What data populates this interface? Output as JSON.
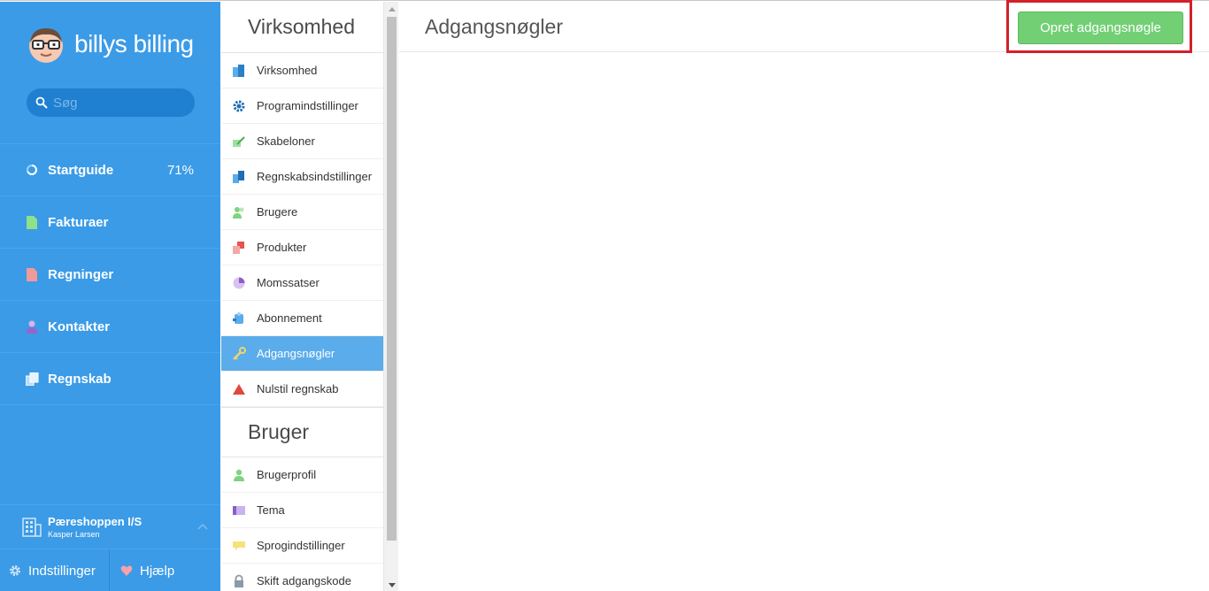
{
  "brand": {
    "name": "billys billing"
  },
  "search": {
    "placeholder": "Søg"
  },
  "sidebar": {
    "items": [
      {
        "label": "Startguide",
        "percent": "71%"
      },
      {
        "label": "Fakturaer"
      },
      {
        "label": "Regninger"
      },
      {
        "label": "Kontakter"
      },
      {
        "label": "Regnskab"
      }
    ],
    "org_name": "Pæreshoppen I/S",
    "org_user": "Kasper Larsen",
    "settings_label": "Indstillinger",
    "help_label": "Hjælp"
  },
  "settings": {
    "company_title": "Virksomhed",
    "company_items": [
      "Virksomhed",
      "Programindstillinger",
      "Skabeloner",
      "Regnskabsindstillinger",
      "Brugere",
      "Produkter",
      "Momssatser",
      "Abonnement",
      "Adgangsnøgler",
      "Nulstil regnskab"
    ],
    "user_title": "Bruger",
    "user_items": [
      "Brugerprofil",
      "Tema",
      "Sprogindstillinger",
      "Skift adgangskode"
    ],
    "active": "Adgangsnøgler"
  },
  "main": {
    "title": "Adgangsnøgler",
    "create_button": "Opret adgangsnøgle"
  },
  "colors": {
    "sidebar": "#3b9be7",
    "active_item": "#5aaceb",
    "cta": "#72cf74",
    "highlight": "#d4202a"
  }
}
